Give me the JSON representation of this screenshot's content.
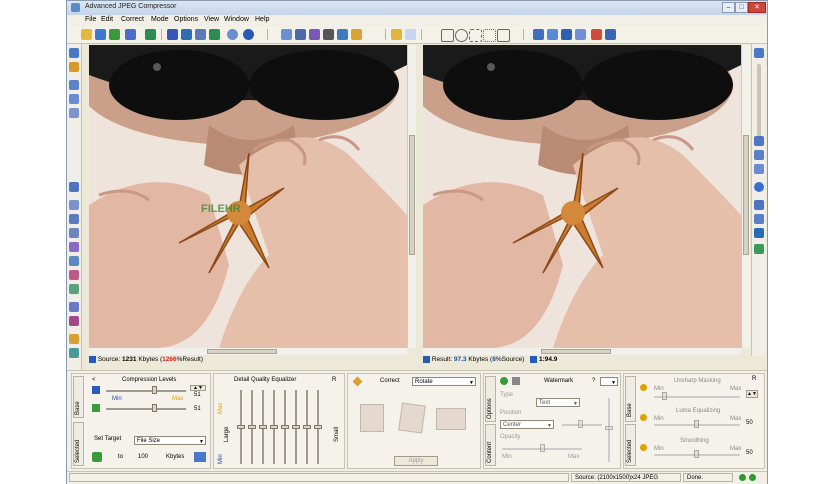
{
  "window": {
    "title": "Advanced JPEG Compressor",
    "buttons": [
      "–",
      "□",
      "✕"
    ]
  },
  "menu": [
    "File",
    "Edit",
    "Correct",
    "Mode",
    "Options",
    "View",
    "Window",
    "Help"
  ],
  "source_status": {
    "label": "Source:",
    "size": "1231",
    "unit": "Kbytes",
    "pct": "1266",
    "pct_suffix": "%Result)",
    "pct_prefix": "("
  },
  "result_status": {
    "label": "Result:",
    "size": "97.3",
    "unit": "Kbytes",
    "pct_prefix": "(",
    "pct": "8",
    "pct_suffix": "%Source)",
    "ratio": "1:94.9"
  },
  "watermark_text": "FILEHR",
  "compression": {
    "title": "Compression Levels",
    "top_value": "51",
    "bottom_value": "51",
    "min_label": "Min",
    "max_label": "Max",
    "level": 0.6,
    "side_tab_base": "Base",
    "side_tab_selected": "Selected",
    "set_target": "Set Target",
    "target_mode": "File Size",
    "to_label": "to",
    "target_value": "100",
    "target_unit": "Kbytes"
  },
  "equalizer": {
    "title": "Detail Quality Equalizer",
    "large_label": "Large",
    "small_label": "Small",
    "max_label": "Max",
    "min_label": "Min",
    "r_label": "R",
    "band_levels": [
      0.5,
      0.5,
      0.5,
      0.5,
      0.5,
      0.5,
      0.5,
      0.5
    ]
  },
  "correct": {
    "label": "Correct",
    "mode": "Rotate",
    "apply": "Apply"
  },
  "watermark": {
    "title": "Watermark",
    "help": "?",
    "tab_options": "Options",
    "tab_content": "Content",
    "type_label": "Type",
    "type_value": "Text",
    "position_label": "Position",
    "position_value": "Center",
    "opacity_label": "Opacity",
    "min_label": "Min",
    "max_label": "Max"
  },
  "adjust": {
    "tab_base": "Base",
    "tab_selected": "Selected",
    "r_label": "R",
    "items": [
      {
        "name": "Unsharp Masking",
        "value": "",
        "min": "Min",
        "max": "Max"
      },
      {
        "name": "Luma Equalizing",
        "value": "50",
        "min": "Min",
        "max": "Max"
      },
      {
        "name": "Smoothing",
        "value": "50",
        "min": "Min",
        "max": "Max"
      }
    ]
  },
  "statusbar": {
    "source": "Source: (2100x1500)x24 JPEG",
    "state": "Done."
  },
  "colors": {
    "accent": "#1f4fa8",
    "red": "#d62020",
    "orange": "#e0a000",
    "green": "#2c9a2c"
  },
  "icons": {
    "toolbar": [
      "open-icon",
      "save-icon",
      "refresh-icon",
      "save-as-icon",
      "batch-icon",
      "export-icon",
      "save-web-icon",
      "settings-icon",
      "info-icon",
      "help-icon",
      "preview-icon",
      "crop-icon",
      "rotate-icon",
      "eye-icon",
      "zoom-icon",
      "hand-icon",
      "select-icon",
      "rect-select-icon",
      "ellipse-select-icon",
      "lasso-icon",
      "magic-icon",
      "layout-icon",
      "split-icon",
      "tile-icon",
      "window-icon",
      "fit-icon"
    ]
  }
}
